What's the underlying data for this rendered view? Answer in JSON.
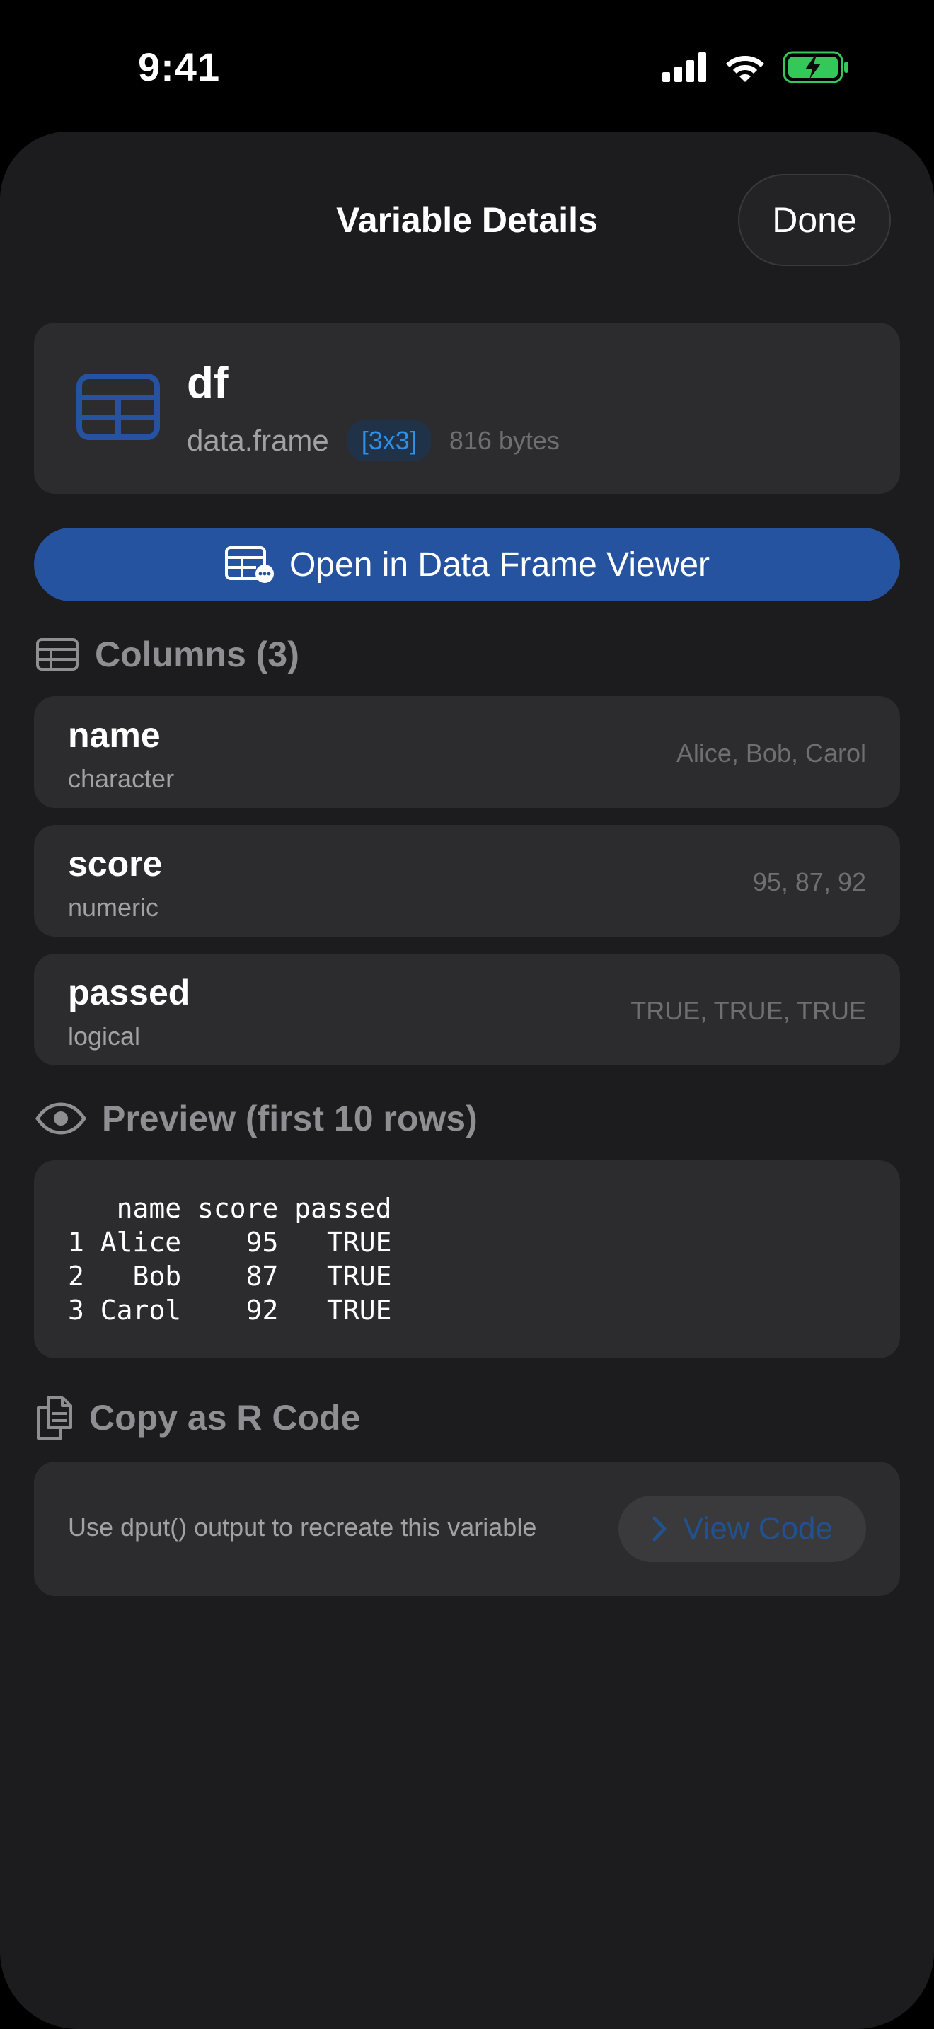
{
  "status_bar": {
    "time": "9:41"
  },
  "header": {
    "title": "Variable Details",
    "done_label": "Done"
  },
  "variable": {
    "name": "df",
    "type": "data.frame",
    "dims": "[3x3]",
    "size": "816 bytes",
    "icon": "table-icon"
  },
  "open_viewer": {
    "label": "Open in Data Frame Viewer",
    "icon": "table-viewer-icon"
  },
  "columns_section": {
    "title": "Columns (3)",
    "icon": "grid-icon",
    "items": [
      {
        "name": "name",
        "type": "character",
        "preview": "Alice, Bob, Carol"
      },
      {
        "name": "score",
        "type": "numeric",
        "preview": "95, 87, 92"
      },
      {
        "name": "passed",
        "type": "logical",
        "preview": "TRUE, TRUE, TRUE"
      }
    ]
  },
  "preview_section": {
    "title": "Preview (first 10 rows)",
    "icon": "eye-icon",
    "text": "   name score passed\n1 Alice    95   TRUE\n2   Bob    87   TRUE\n3 Carol    92   TRUE"
  },
  "copy_section": {
    "title": "Copy as R Code",
    "icon": "copy-icon",
    "description": "Use dput() output to recreate this variable",
    "view_code_label": "View Code"
  },
  "colors": {
    "background": "#000000",
    "sheet": "#1c1c1e",
    "card": "#2c2c2e",
    "accent_blue": "#2553a0",
    "link_blue": "#2f8fe6",
    "battery_green": "#34c759",
    "secondary_text": "#8e8e93"
  }
}
